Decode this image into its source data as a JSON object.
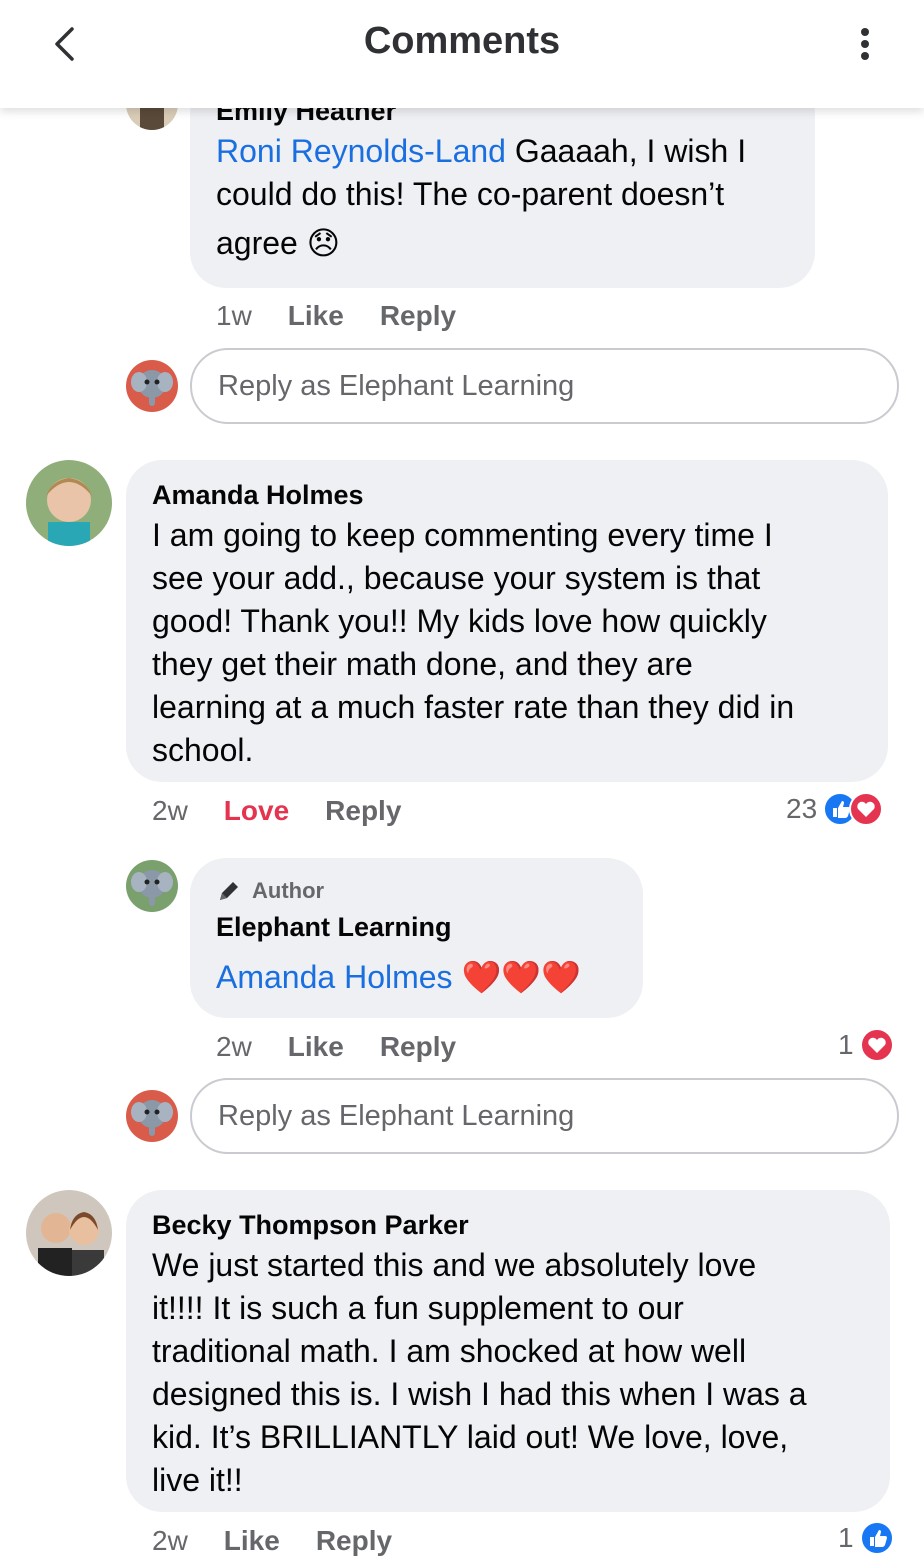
{
  "header": {
    "title": "Comments"
  },
  "reply_placeholder": "Reply as Elephant Learning",
  "comments": [
    {
      "name": "Emily Heather",
      "mention": "Roni Reynolds-Land",
      "text_line1": " Gaaaah, I wish I",
      "text_line2": "could do this! The co-parent doesn’t",
      "text_line3": "agree",
      "emoji": "😞",
      "time": "1w",
      "like": "Like",
      "reply": "Reply"
    },
    {
      "name": "Amanda Holmes",
      "lines": [
        "I am going to keep commenting every time I",
        "see your add., because your system is that",
        "good! Thank you!! My kids love how quickly",
        "they get their math done, and they are",
        "learning at a much faster rate than they did in",
        "school."
      ],
      "time": "2w",
      "love": "Love",
      "reply": "Reply",
      "reaction_count": "23"
    },
    {
      "author_tag": "Author",
      "name": "Elephant Learning",
      "mention": "Amanda Holmes",
      "emoji": "❤️❤️❤️",
      "time": "2w",
      "like": "Like",
      "reply": "Reply",
      "reaction_count": "1"
    },
    {
      "name": "Becky Thompson Parker",
      "lines": [
        "We just started this and we absolutely love",
        "it!!!! It is such a fun supplement to our",
        "traditional math. I am shocked at how well",
        "designed this is. I wish I had this when I was a",
        "kid. It’s BRILLIANTLY laid out! We love, love,",
        "live  it!!"
      ],
      "time": "2w",
      "like": "Like",
      "reply": "Reply",
      "reaction_count": "1"
    }
  ],
  "colors": {
    "mention": "#1a6fe0",
    "love": "#e4344f",
    "like_blue": "#1877f2",
    "bubble": "#eff0f4"
  },
  "icons": [
    "back-chevron-icon",
    "more-vertical-icon",
    "pencil-icon",
    "like-reaction-icon",
    "love-reaction-icon"
  ]
}
